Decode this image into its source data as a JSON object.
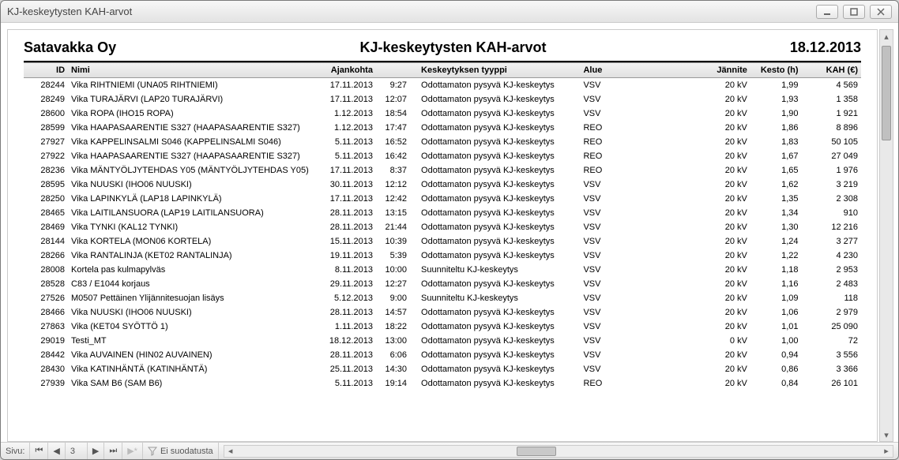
{
  "window": {
    "title": "KJ-keskeytysten KAH-arvot"
  },
  "report": {
    "company": "Satavakka Oy",
    "title": "KJ-keskeytysten KAH-arvot",
    "date": "18.12.2013"
  },
  "columns": {
    "id": "ID",
    "nimi": "Nimi",
    "ajankohta": "Ajankohta",
    "tyyppi": "Keskeytyksen tyyppi",
    "alue": "Alue",
    "jannite": "Jännite",
    "kesto": "Kesto (h)",
    "kah": "KAH (€)"
  },
  "rows": [
    {
      "id": "28244",
      "nimi": "Vika RIHTNIEMI (UNA05 RIHTNIEMI)",
      "date": "17.11.2013",
      "time": "9:27",
      "type": "Odottamaton pysyvä KJ-keskeytys",
      "alue": "VSV",
      "jann": "20 kV",
      "kesto": "1,99",
      "kah": "4 569"
    },
    {
      "id": "28249",
      "nimi": "Vika TURAJÄRVI (LAP20 TURAJÄRVI)",
      "date": "17.11.2013",
      "time": "12:07",
      "type": "Odottamaton pysyvä KJ-keskeytys",
      "alue": "VSV",
      "jann": "20 kV",
      "kesto": "1,93",
      "kah": "1 358"
    },
    {
      "id": "28600",
      "nimi": "Vika ROPA (IHO15 ROPA)",
      "date": "1.12.2013",
      "time": "18:54",
      "type": "Odottamaton pysyvä KJ-keskeytys",
      "alue": "VSV",
      "jann": "20 kV",
      "kesto": "1,90",
      "kah": "1 921"
    },
    {
      "id": "28599",
      "nimi": "Vika HAAPASAARENTIE S327 (HAAPASAARENTIE S327)",
      "date": "1.12.2013",
      "time": "17:47",
      "type": "Odottamaton pysyvä KJ-keskeytys",
      "alue": "REO",
      "jann": "20 kV",
      "kesto": "1,86",
      "kah": "8 896"
    },
    {
      "id": "27927",
      "nimi": "Vika KAPPELINSALMI S046 (KAPPELINSALMI S046)",
      "date": "5.11.2013",
      "time": "16:52",
      "type": "Odottamaton pysyvä KJ-keskeytys",
      "alue": "REO",
      "jann": "20 kV",
      "kesto": "1,83",
      "kah": "50 105"
    },
    {
      "id": "27922",
      "nimi": "Vika HAAPASAARENTIE S327 (HAAPASAARENTIE S327)",
      "date": "5.11.2013",
      "time": "16:42",
      "type": "Odottamaton pysyvä KJ-keskeytys",
      "alue": "REO",
      "jann": "20 kV",
      "kesto": "1,67",
      "kah": "27 049"
    },
    {
      "id": "28236",
      "nimi": "Vika MÄNTYÖLJYTEHDAS Y05 (MÄNTYÖLJYTEHDAS Y05)",
      "date": "17.11.2013",
      "time": "8:37",
      "type": "Odottamaton pysyvä KJ-keskeytys",
      "alue": "REO",
      "jann": "20 kV",
      "kesto": "1,65",
      "kah": "1 976"
    },
    {
      "id": "28595",
      "nimi": "Vika NUUSKI (IHO06 NUUSKI)",
      "date": "30.11.2013",
      "time": "12:12",
      "type": "Odottamaton pysyvä KJ-keskeytys",
      "alue": "VSV",
      "jann": "20 kV",
      "kesto": "1,62",
      "kah": "3 219"
    },
    {
      "id": "28250",
      "nimi": "Vika LAPINKYLÄ (LAP18 LAPINKYLÄ)",
      "date": "17.11.2013",
      "time": "12:42",
      "type": "Odottamaton pysyvä KJ-keskeytys",
      "alue": "VSV",
      "jann": "20 kV",
      "kesto": "1,35",
      "kah": "2 308"
    },
    {
      "id": "28465",
      "nimi": "Vika LAITILANSUORA (LAP19 LAITILANSUORA)",
      "date": "28.11.2013",
      "time": "13:15",
      "type": "Odottamaton pysyvä KJ-keskeytys",
      "alue": "VSV",
      "jann": "20 kV",
      "kesto": "1,34",
      "kah": "910"
    },
    {
      "id": "28469",
      "nimi": "Vika TYNKI (KAL12 TYNKI)",
      "date": "28.11.2013",
      "time": "21:44",
      "type": "Odottamaton pysyvä KJ-keskeytys",
      "alue": "VSV",
      "jann": "20 kV",
      "kesto": "1,30",
      "kah": "12 216"
    },
    {
      "id": "28144",
      "nimi": "Vika KORTELA (MON06 KORTELA)",
      "date": "15.11.2013",
      "time": "10:39",
      "type": "Odottamaton pysyvä KJ-keskeytys",
      "alue": "VSV",
      "jann": "20 kV",
      "kesto": "1,24",
      "kah": "3 277"
    },
    {
      "id": "28266",
      "nimi": "Vika RANTALINJA (KET02 RANTALINJA)",
      "date": "19.11.2013",
      "time": "5:39",
      "type": "Odottamaton pysyvä KJ-keskeytys",
      "alue": "VSV",
      "jann": "20 kV",
      "kesto": "1,22",
      "kah": "4 230"
    },
    {
      "id": "28008",
      "nimi": "Kortela pas kulmapylväs",
      "date": "8.11.2013",
      "time": "10:00",
      "type": "Suunniteltu KJ-keskeytys",
      "alue": "VSV",
      "jann": "20 kV",
      "kesto": "1,18",
      "kah": "2 953"
    },
    {
      "id": "28528",
      "nimi": "C83 / E1044  korjaus",
      "date": "29.11.2013",
      "time": "12:27",
      "type": "Odottamaton pysyvä KJ-keskeytys",
      "alue": "VSV",
      "jann": "20 kV",
      "kesto": "1,16",
      "kah": "2 483"
    },
    {
      "id": "27526",
      "nimi": "M0507 Pettäinen Ylijännitesuojan lisäys",
      "date": "5.12.2013",
      "time": "9:00",
      "type": "Suunniteltu KJ-keskeytys",
      "alue": "VSV",
      "jann": "20 kV",
      "kesto": "1,09",
      "kah": "118"
    },
    {
      "id": "28466",
      "nimi": "Vika NUUSKI (IHO06 NUUSKI)",
      "date": "28.11.2013",
      "time": "14:57",
      "type": "Odottamaton pysyvä KJ-keskeytys",
      "alue": "VSV",
      "jann": "20 kV",
      "kesto": "1,06",
      "kah": "2 979"
    },
    {
      "id": "27863",
      "nimi": "Vika  (KET04 SYÖTTÖ 1)",
      "date": "1.11.2013",
      "time": "18:22",
      "type": "Odottamaton pysyvä KJ-keskeytys",
      "alue": "VSV",
      "jann": "20 kV",
      "kesto": "1,01",
      "kah": "25 090"
    },
    {
      "id": "29019",
      "nimi": "Testi_MT",
      "date": "18.12.2013",
      "time": "13:00",
      "type": "Odottamaton pysyvä KJ-keskeytys",
      "alue": "VSV",
      "jann": "0 kV",
      "kesto": "1,00",
      "kah": "72"
    },
    {
      "id": "28442",
      "nimi": "Vika AUVAINEN (HIN02 AUVAINEN)",
      "date": "28.11.2013",
      "time": "6:06",
      "type": "Odottamaton pysyvä KJ-keskeytys",
      "alue": "VSV",
      "jann": "20 kV",
      "kesto": "0,94",
      "kah": "3 556"
    },
    {
      "id": "28430",
      "nimi": "Vika KATINHÄNTÄ (KATINHÄNTÄ)",
      "date": "25.11.2013",
      "time": "14:30",
      "type": "Odottamaton pysyvä KJ-keskeytys",
      "alue": "VSV",
      "jann": "20 kV",
      "kesto": "0,86",
      "kah": "3 366"
    },
    {
      "id": "27939",
      "nimi": "Vika SAM B6 (SAM B6)",
      "date": "5.11.2013",
      "time": "19:14",
      "type": "Odottamaton pysyvä KJ-keskeytys",
      "alue": "REO",
      "jann": "20 kV",
      "kesto": "0,84",
      "kah": "26 101"
    }
  ],
  "statusbar": {
    "page_label": "Sivu:",
    "page": "3",
    "filter_label": "Ei suodatusta"
  }
}
